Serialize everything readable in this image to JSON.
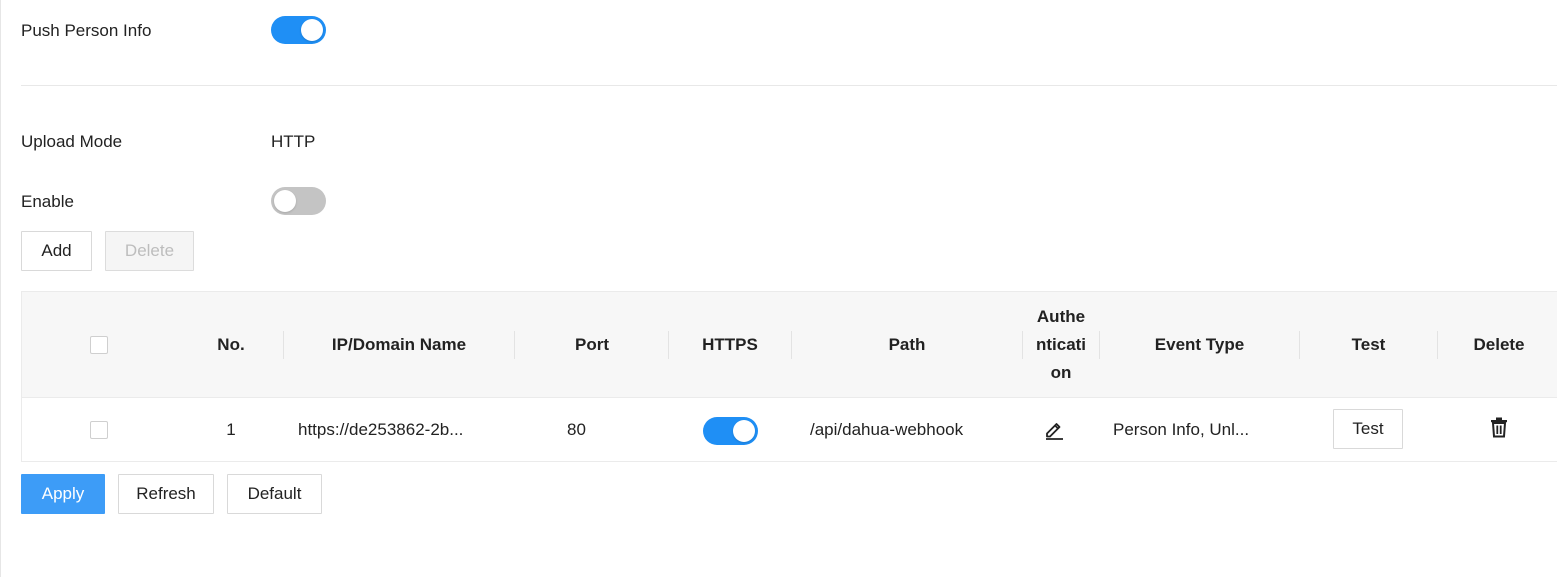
{
  "push_person_info": {
    "label": "Push Person Info",
    "enabled": true
  },
  "upload_mode": {
    "label": "Upload Mode",
    "value": "HTTP"
  },
  "enable": {
    "label": "Enable",
    "enabled": false
  },
  "toolbar": {
    "add_label": "Add",
    "delete_label": "Delete"
  },
  "table": {
    "headers": {
      "no": "No.",
      "ip_domain": "IP/Domain Name",
      "port": "Port",
      "https": "HTTPS",
      "path": "Path",
      "authentication": "Authe\nnticati\non",
      "event_type": "Event Type",
      "test": "Test",
      "delete": "Delete"
    },
    "rows": [
      {
        "no": "1",
        "ip_domain": "https://de253862-2b...",
        "port": "80",
        "https": true,
        "path": "/api/dahua-webhook",
        "event_type": "Person Info, Unl...",
        "test_label": "Test"
      }
    ]
  },
  "footer": {
    "apply_label": "Apply",
    "refresh_label": "Refresh",
    "default_label": "Default"
  },
  "colors": {
    "accent": "#1f8ff5",
    "primary_button": "#3d9cf7",
    "switch_off": "#c4c4c4",
    "header_bg": "#f7f7f7"
  },
  "icons": {
    "edit": "pencil-edit-icon",
    "delete": "trash-icon"
  }
}
